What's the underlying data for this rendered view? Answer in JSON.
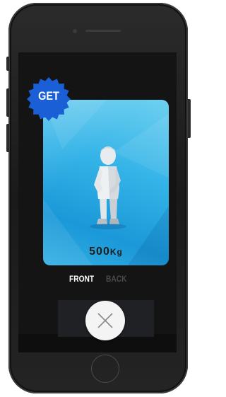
{
  "badge": {
    "label": "GET",
    "color": "#1a5fd6"
  },
  "card": {
    "weight_value": "500",
    "weight_unit": "Kg",
    "background_color": "#35b4e8",
    "figure": "child-statue-icon"
  },
  "tabs": [
    {
      "label": "FRONT",
      "active": true
    },
    {
      "label": "BACK",
      "active": false
    }
  ],
  "actions": {
    "close_icon": "close-icon"
  }
}
